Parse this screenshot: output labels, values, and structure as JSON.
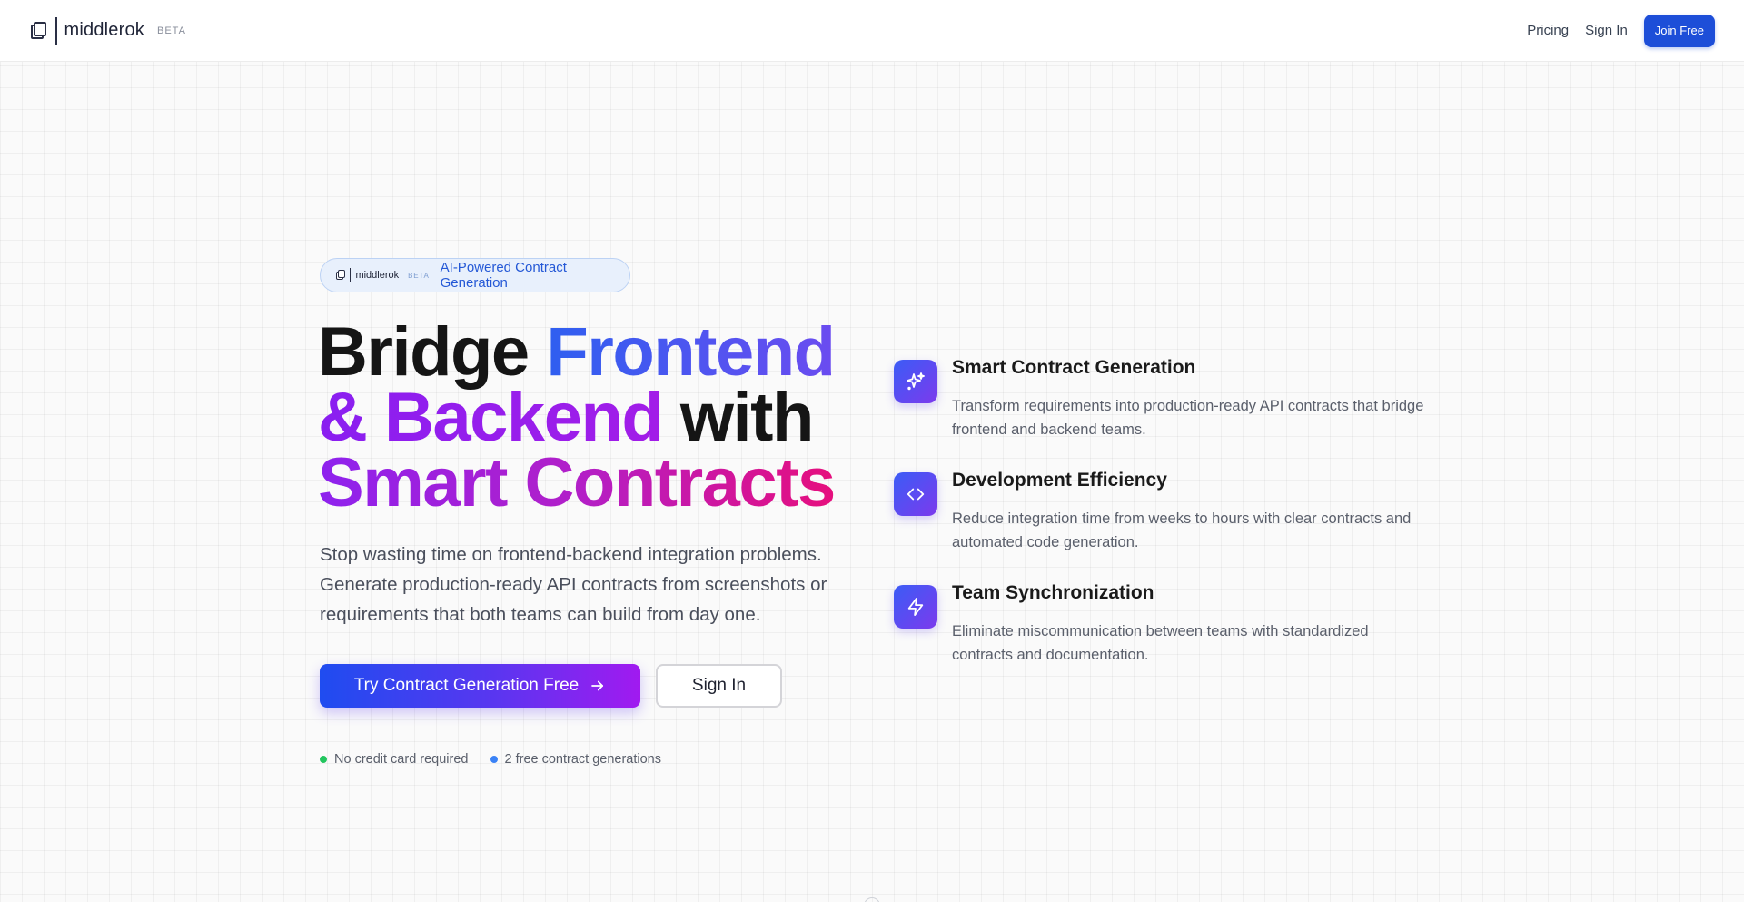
{
  "header": {
    "brand_name": "middlerok",
    "beta": "BETA",
    "nav": {
      "pricing": "Pricing",
      "sign_in": "Sign In",
      "join_free": "Join Free"
    }
  },
  "hero": {
    "pill": {
      "brand_name": "middlerok",
      "beta": "BETA",
      "text": "AI-Powered Contract Generation"
    },
    "headline": {
      "part1": "Bridge ",
      "part2": "Frontend",
      "part3": "& Backend",
      "part4": " with",
      "part5": "Smart Contracts"
    },
    "subtitle": "Stop wasting time on frontend-backend integration problems. Generate production-ready API contracts from screenshots or requirements that both teams can build from day one.",
    "cta_primary": "Try Contract Generation Free",
    "cta_secondary": "Sign In",
    "notes": [
      {
        "text": "No credit card required",
        "color": "#22c55e"
      },
      {
        "text": "2 free contract generations",
        "color": "#3b82f6"
      }
    ]
  },
  "features": [
    {
      "icon": "sparkles-icon",
      "title": "Smart Contract Generation",
      "description": "Transform requirements into production-ready API contracts that bridge frontend and backend teams."
    },
    {
      "icon": "code-icon",
      "title": "Development Efficiency",
      "description": "Reduce integration time from weeks to hours with clear contracts and automated code generation."
    },
    {
      "icon": "lightning-icon",
      "title": "Team Synchronization",
      "description": "Eliminate miscommunication between teams with standardized contracts and documentation."
    }
  ],
  "colors": {
    "accent": "#1d4ed8",
    "gradient_start": "#1f4cf0",
    "gradient_end": "#a11af0",
    "headline_pink": "#e60f7d"
  }
}
